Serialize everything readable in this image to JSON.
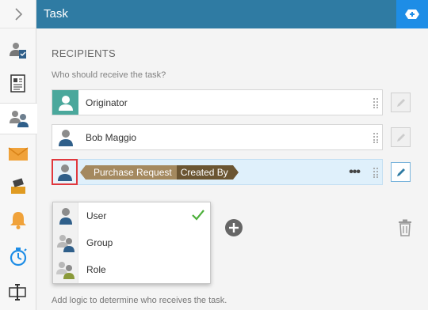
{
  "header": {
    "title": "Task"
  },
  "recipients": {
    "section_title": "RECIPIENTS",
    "subtitle": "Who should receive the task?",
    "rows": [
      {
        "label": "Originator"
      },
      {
        "label": "Bob Maggio"
      }
    ],
    "selected_row": {
      "tag_name": "Purchase Request",
      "tag_field": "Created By",
      "more": "•••"
    }
  },
  "type_menu": {
    "items": [
      {
        "label": "User",
        "checked": true
      },
      {
        "label": "Group",
        "checked": false
      },
      {
        "label": "Role",
        "checked": false
      }
    ]
  },
  "footer": {
    "text": "Add logic to determine who receives the task."
  },
  "colors": {
    "header": "#2f7ba3",
    "accent": "#1e8de6",
    "teal": "#4aa89c",
    "check": "#4caf3a",
    "highlight": "#e0383e"
  }
}
